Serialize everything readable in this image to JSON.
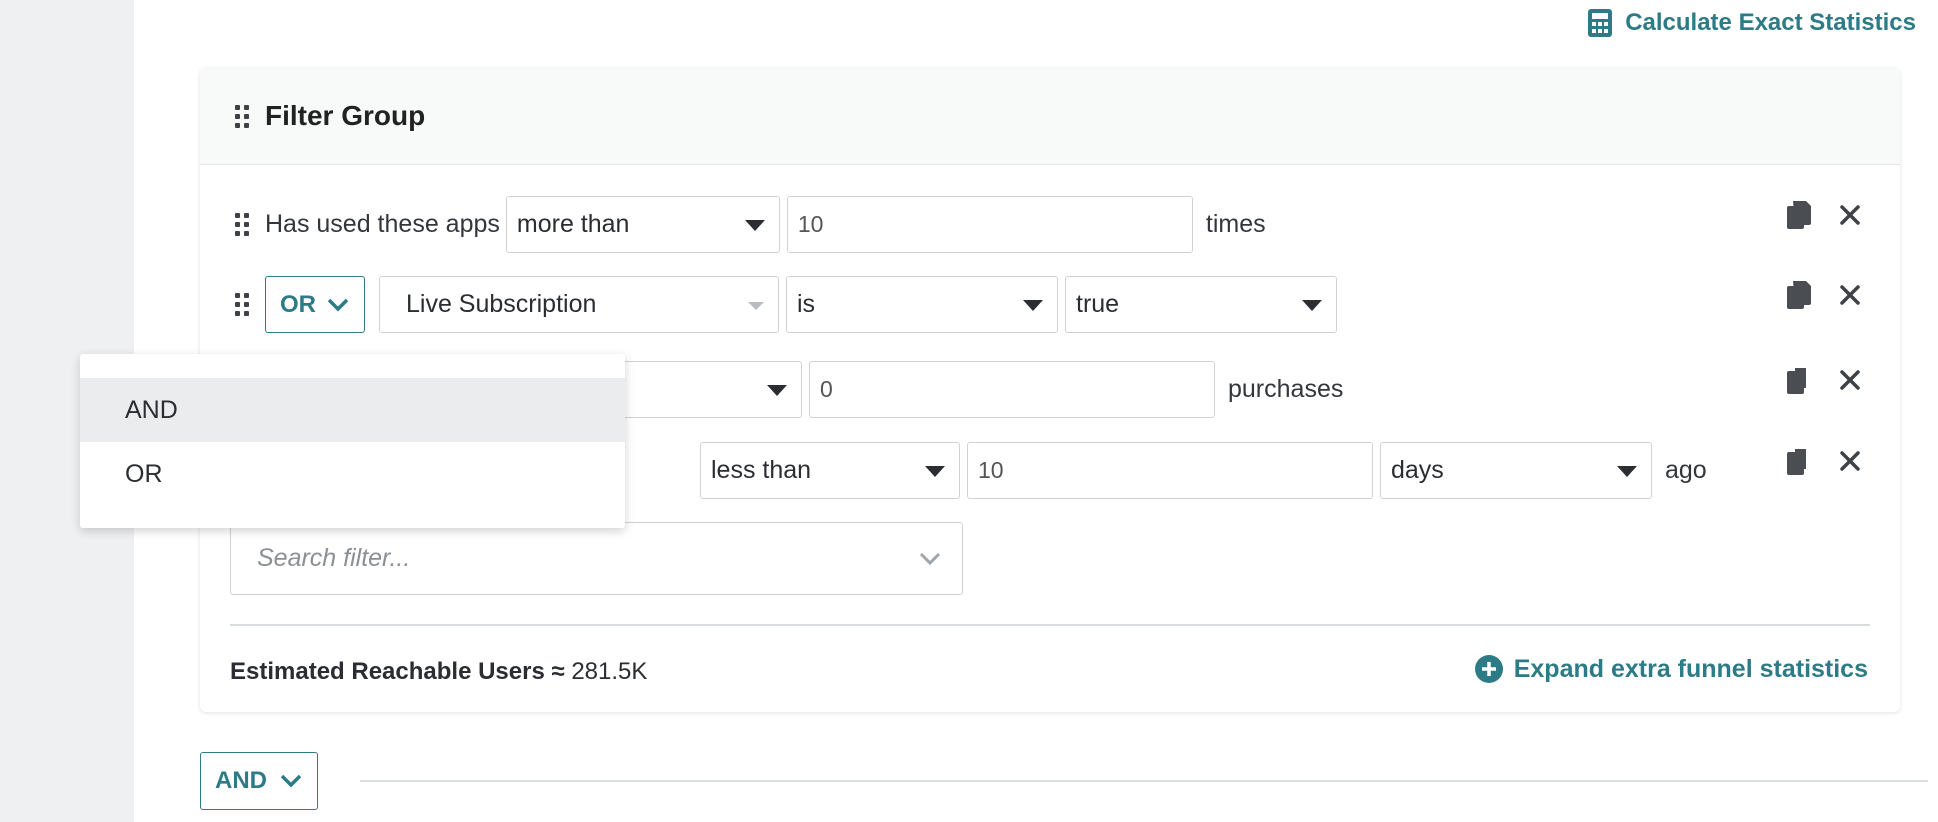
{
  "header": {
    "calculate_label": "Calculate Exact Statistics"
  },
  "filter_group": {
    "title": "Filter Group",
    "row1": {
      "label": "Has used these apps",
      "comparator": "more than",
      "value": "10",
      "suffix": "times"
    },
    "row2": {
      "operator": "OR",
      "property": "Live Subscription",
      "comparator": "is",
      "value": "true"
    },
    "row3": {
      "value": "0",
      "suffix": "purchases"
    },
    "row4": {
      "comparator": "less than",
      "value": "10",
      "unit": "days",
      "suffix": "ago"
    },
    "search": {
      "placeholder": "Search filter..."
    },
    "estimate": {
      "label": "Estimated Reachable Users ≈",
      "value": "281.5K"
    },
    "expand_label": "Expand extra funnel statistics"
  },
  "group_operator": "AND",
  "dropdown": {
    "options": [
      "AND",
      "OR"
    ],
    "highlighted": "AND"
  },
  "colors": {
    "accent": "#2d7b86",
    "text": "#2a2d31",
    "border": "#cfd3d6"
  }
}
